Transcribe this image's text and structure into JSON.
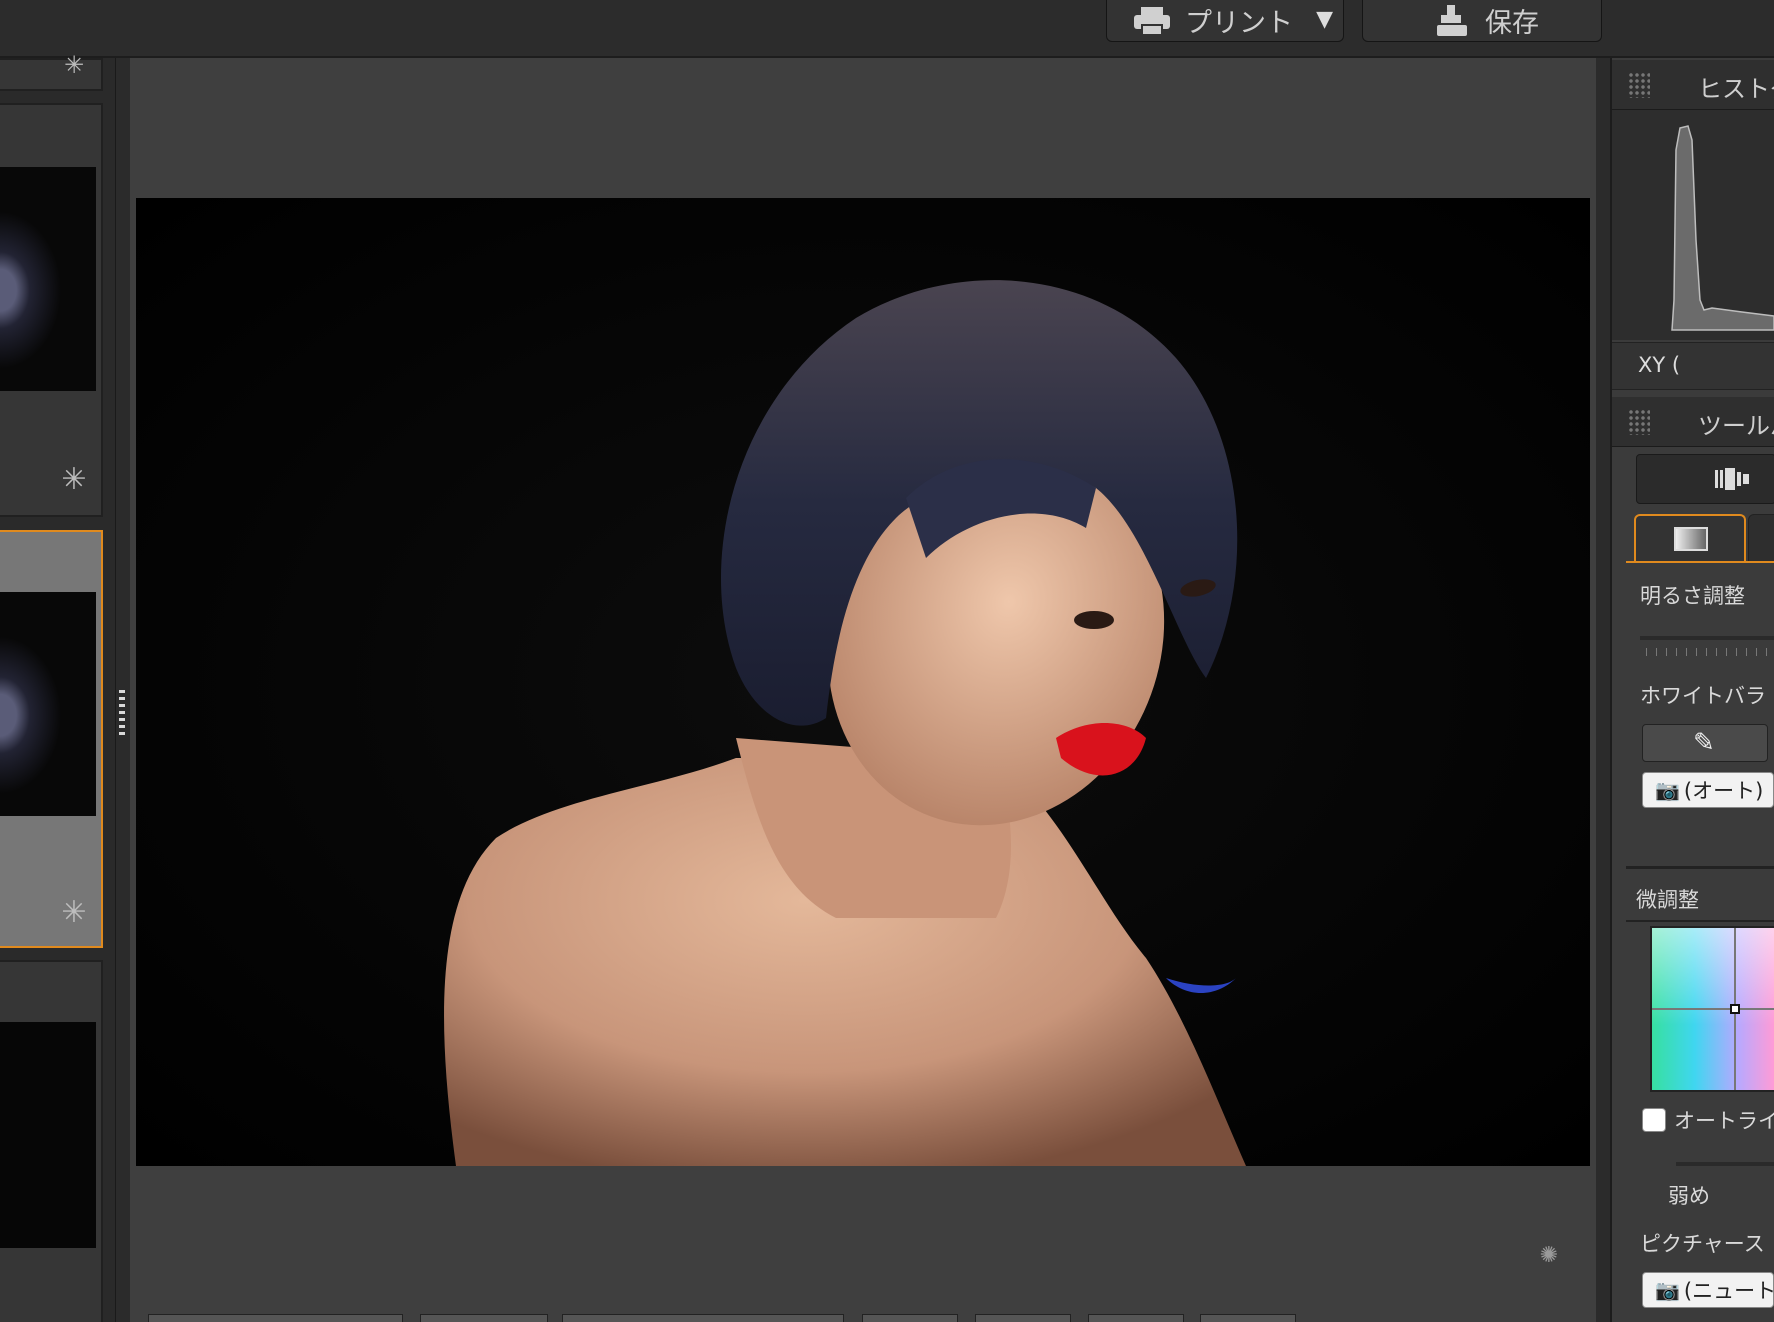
{
  "toolbar": {
    "print_label": "プリント",
    "save_label": "保存"
  },
  "filmstrip": {
    "thumbnails": [
      {
        "selected": false,
        "star_icon": "rating-star-icon"
      },
      {
        "selected": true,
        "star_icon": "rating-star-icon"
      },
      {
        "selected": false
      }
    ]
  },
  "panels": {
    "histogram_title": "ヒストグ",
    "xy_label": "XY (",
    "toolbox_title": "ツールバ"
  },
  "adjust": {
    "brightness_label": "明るさ調整",
    "white_balance_label": "ホワイトバラ",
    "wb_auto_label": "(オート)",
    "fine_tune_label": "微調整",
    "auto_light_label": "オートライ",
    "weak_label": "弱め",
    "picture_style_label": "ピクチャース",
    "picture_style_value": "(ニュート"
  },
  "colors": {
    "accent": "#e08a1e",
    "panel_bg": "#3b3b3b",
    "viewer_bg": "#3f3f3f"
  }
}
